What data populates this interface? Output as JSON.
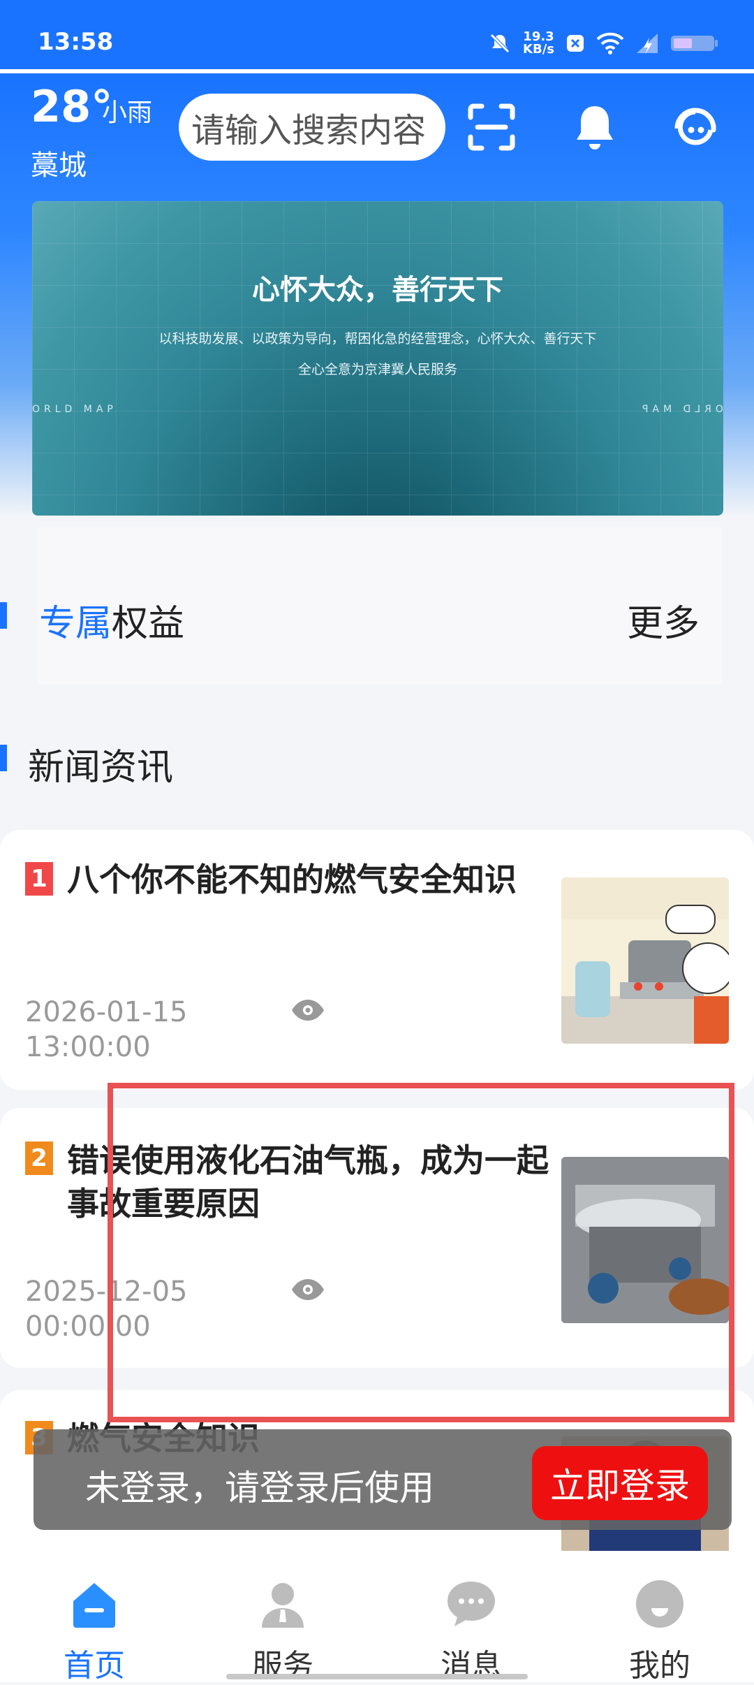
{
  "status_bar": {
    "time": "13:58",
    "net_speed": "19.3",
    "net_unit": "KB/s"
  },
  "header": {
    "temperature": "28°",
    "weather": "小雨",
    "city": "藁城",
    "search_placeholder": "请输入搜索内容"
  },
  "banner": {
    "title": "心怀大众，善行天下",
    "line1": "以科技助发展、以政策为导向，帮困化急的经营理念，心怀大众、善行天下",
    "line2": "全心全意为京津冀人民服务",
    "map_left": "ORLD MAP",
    "map_right": "ORLD MAP"
  },
  "benefits": {
    "title_highlight": "专属",
    "title_rest": "权益",
    "more": "更多"
  },
  "news": {
    "section_title": "新闻资讯",
    "items": [
      {
        "rank": "1",
        "title": "八个你不能不知的燃气安全知识",
        "date": "2026-01-15",
        "time": "13:00:00",
        "rank_color": "#f04848"
      },
      {
        "rank": "2",
        "title": "错误使用液化石油气瓶，成为一起事故重要原因",
        "date": "2025-12-05",
        "time": "00:00:00",
        "rank_color": "#f08a1c"
      },
      {
        "rank": "3",
        "title": "燃气安全知识",
        "rank_color": "#f08a1c"
      }
    ]
  },
  "toast": {
    "message": "未登录，请登录后使用",
    "button": "立即登录"
  },
  "tabbar": {
    "items": [
      {
        "label": "首页"
      },
      {
        "label": "服务"
      },
      {
        "label": "消息"
      },
      {
        "label": "我的"
      }
    ]
  }
}
